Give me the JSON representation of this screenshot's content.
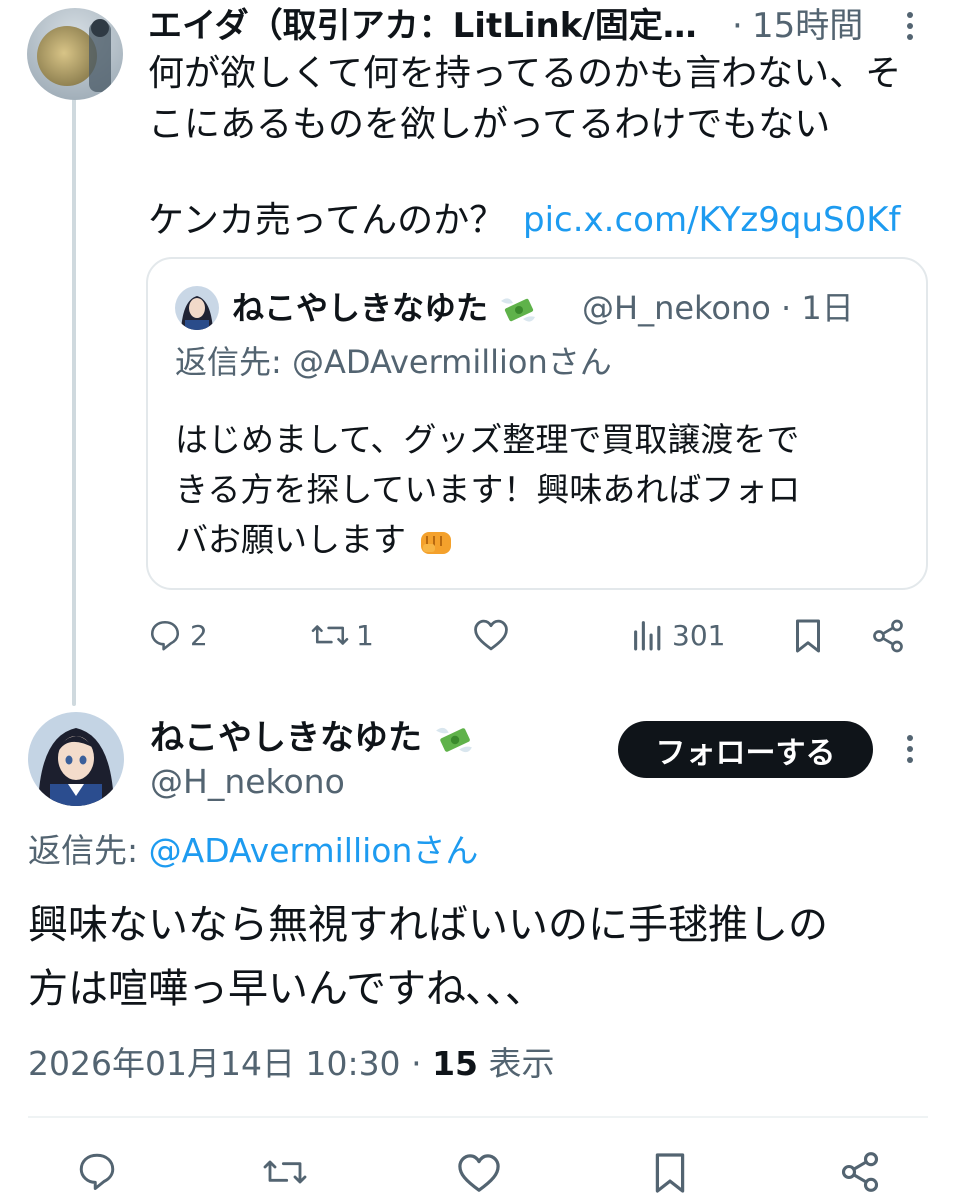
{
  "parent_tweet": {
    "display_name": "エイダ（取引アカ：LitLink/固定…",
    "separator": "·",
    "time": "15時間",
    "text_line1": "何が欲しくて何を持ってるのかも言わない、そ",
    "text_line2": "こにあるものを欲しがってるわけでもない",
    "text_line3": "ケンカ売ってんのか？",
    "link": "pic.x.com/KYz9quS0Kf",
    "quote": {
      "display_name": "ねこやしきなゆた",
      "handle": "@H_nekono",
      "separator": "·",
      "time": "1日",
      "reply_prefix": "返信先:",
      "reply_to": "@ADAvermillionさん",
      "text_line1": "はじめまして、グッズ整理で買取譲渡をで",
      "text_line2": "きる方を探しています！興味あればフォロ",
      "text_line3": "バお願いします"
    },
    "actions": {
      "replies": "2",
      "reposts": "1",
      "views": "301"
    }
  },
  "main_tweet": {
    "display_name": "ねこやしきなゆた",
    "handle": "@H_nekono",
    "follow_label": "フォローする",
    "reply_prefix": "返信先:",
    "reply_to": "@ADAvermillionさん",
    "text_line1": "興味ないなら無視すればいいのに手毬推しの",
    "text_line2": "方は喧嘩っ早いんですね､､､",
    "date": "2026年01月14日 10:30",
    "separator": "·",
    "view_count": "15",
    "view_label": "表示"
  },
  "colors": {
    "text": "#0f1419",
    "secondary": "#536471",
    "link": "#1d9bf0",
    "border": "#cfd9de"
  }
}
